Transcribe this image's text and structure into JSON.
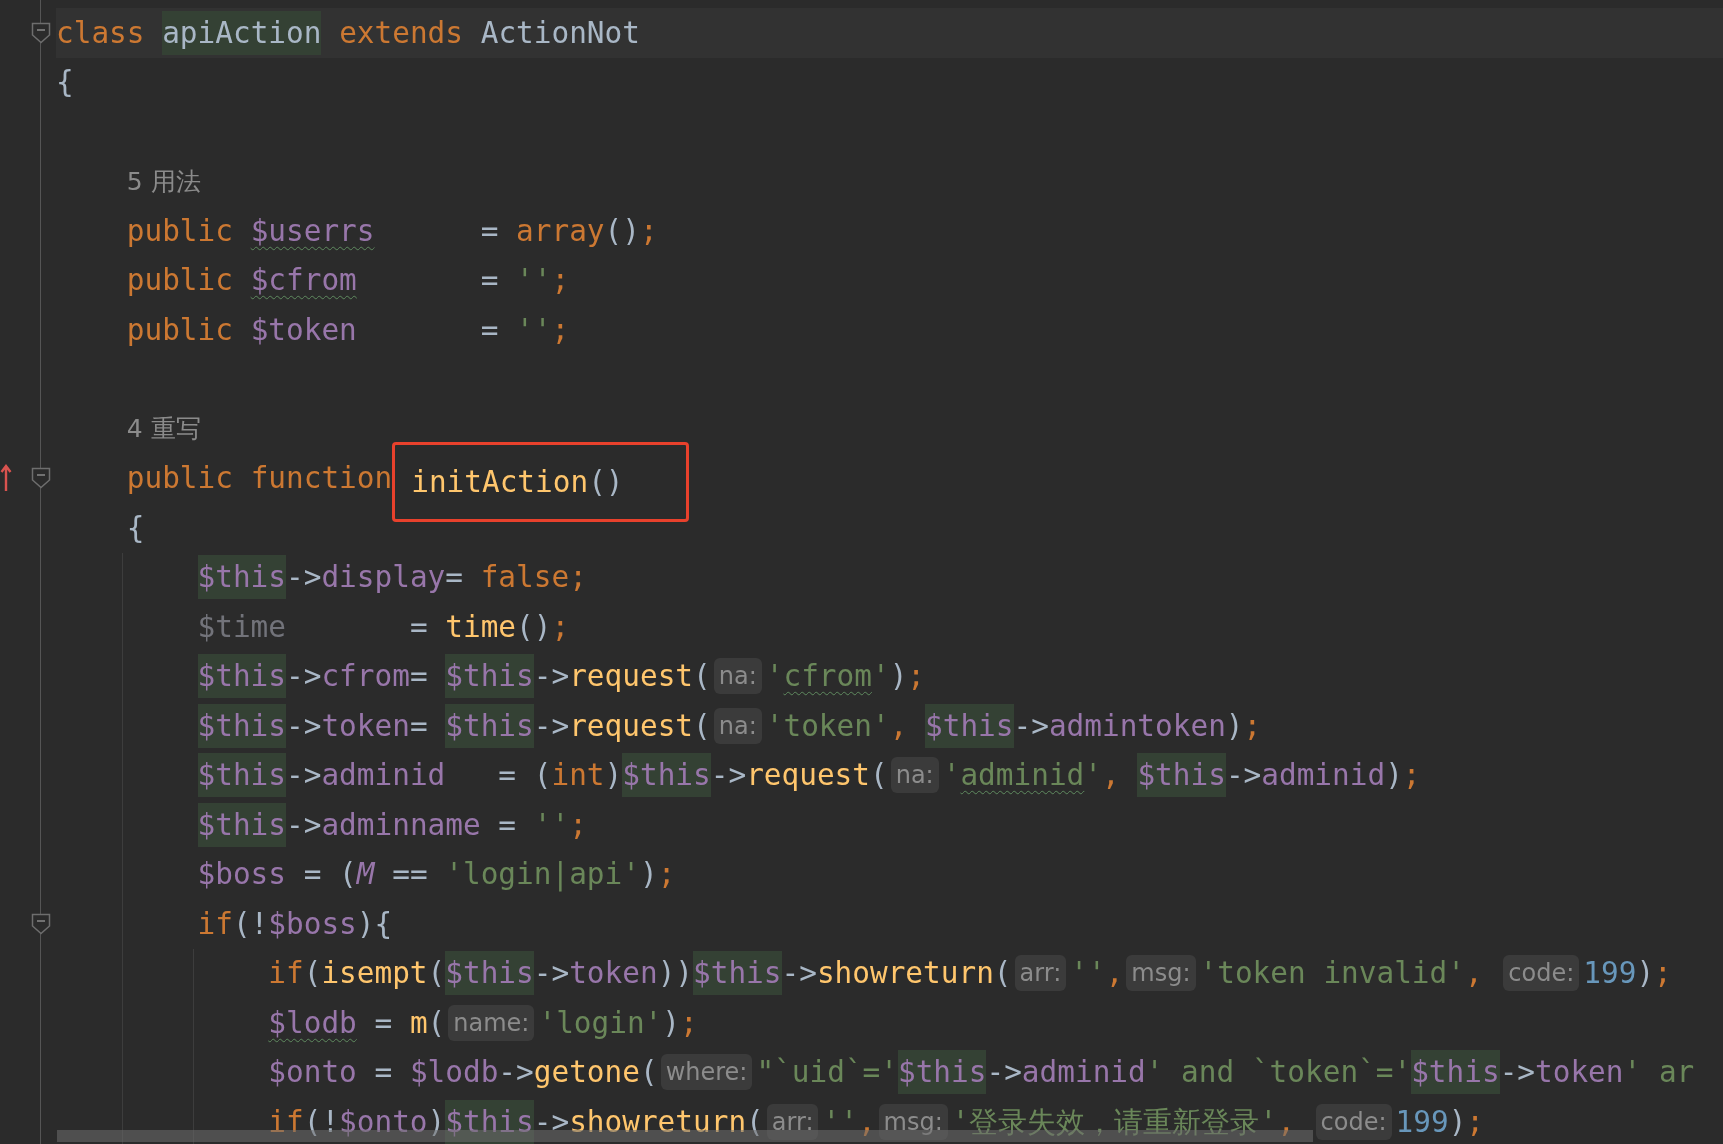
{
  "lines": [
    {
      "fold": true,
      "current": true,
      "tokens": [
        {
          "kind": "kw",
          "text": "class "
        },
        {
          "kind": "clshl",
          "text": "apiAction"
        },
        {
          "kind": "kw",
          "text": " extends "
        },
        {
          "kind": "cls",
          "text": "ActionNot"
        }
      ]
    },
    {
      "tokens": [
        {
          "kind": "plain",
          "text": "{"
        }
      ],
      "children": [
        {
          "kind": "blank"
        },
        {
          "kind": "usage",
          "text": "5 用法"
        },
        {
          "tokens": [
            {
              "kind": "kw",
              "text": "public "
            },
            {
              "kind": "var",
              "text": "$userrs",
              "typo": true
            },
            {
              "kind": "plain",
              "text": "      = "
            },
            {
              "kind": "kw",
              "text": "array"
            },
            {
              "kind": "plain",
              "text": "()"
            },
            {
              "kind": "punct",
              "text": ";"
            }
          ]
        },
        {
          "tokens": [
            {
              "kind": "kw",
              "text": "public "
            },
            {
              "kind": "var",
              "text": "$cfrom",
              "typo": true
            },
            {
              "kind": "plain",
              "text": "       = "
            },
            {
              "kind": "str",
              "text": "''"
            },
            {
              "kind": "punct",
              "text": ";"
            }
          ]
        },
        {
          "tokens": [
            {
              "kind": "kw",
              "text": "public "
            },
            {
              "kind": "var",
              "text": "$token"
            },
            {
              "kind": "plain",
              "text": "       = "
            },
            {
              "kind": "str",
              "text": "''"
            },
            {
              "kind": "punct",
              "text": ";"
            }
          ]
        },
        {
          "kind": "blank"
        },
        {
          "kind": "usage",
          "text": "4 重写"
        },
        {
          "fold": true,
          "override": true,
          "tokens": [
            {
              "kind": "kw",
              "text": "public function"
            },
            {
              "kind": "fn",
              "text": "initAction",
              "boxed": true
            },
            {
              "kind": "plain",
              "text": "()",
              "boxed": true
            }
          ]
        },
        {
          "tokens": [
            {
              "kind": "plain",
              "text": "{"
            }
          ],
          "children": [
            {
              "tokens": [
                {
                  "kind": "this",
                  "text": "$this"
                },
                {
                  "kind": "plain",
                  "text": "->"
                },
                {
                  "kind": "var",
                  "text": "display"
                },
                {
                  "kind": "plain",
                  "text": "= "
                },
                {
                  "kind": "kw",
                  "text": "false"
                },
                {
                  "kind": "punct",
                  "text": ";"
                }
              ]
            },
            {
              "tokens": [
                {
                  "kind": "unused",
                  "text": "$time"
                },
                {
                  "kind": "plain",
                  "text": "       = "
                },
                {
                  "kind": "fn",
                  "text": "time"
                },
                {
                  "kind": "plain",
                  "text": "()"
                },
                {
                  "kind": "punct",
                  "text": ";"
                }
              ]
            },
            {
              "tokens": [
                {
                  "kind": "this",
                  "text": "$this"
                },
                {
                  "kind": "plain",
                  "text": "->"
                },
                {
                  "kind": "var",
                  "text": "cfrom"
                },
                {
                  "kind": "plain",
                  "text": "= "
                },
                {
                  "kind": "this",
                  "text": "$this"
                },
                {
                  "kind": "plain",
                  "text": "->"
                },
                {
                  "kind": "fn",
                  "text": "request"
                },
                {
                  "kind": "plain",
                  "text": "("
                },
                {
                  "kind": "hint",
                  "text": "na:"
                },
                {
                  "kind": "str",
                  "text": "'"
                },
                {
                  "kind": "str",
                  "text": "cfrom",
                  "typo": true
                },
                {
                  "kind": "str",
                  "text": "'"
                },
                {
                  "kind": "plain",
                  "text": ")"
                },
                {
                  "kind": "punct",
                  "text": ";"
                }
              ]
            },
            {
              "tokens": [
                {
                  "kind": "this",
                  "text": "$this"
                },
                {
                  "kind": "plain",
                  "text": "->"
                },
                {
                  "kind": "var",
                  "text": "token"
                },
                {
                  "kind": "plain",
                  "text": "= "
                },
                {
                  "kind": "this",
                  "text": "$this"
                },
                {
                  "kind": "plain",
                  "text": "->"
                },
                {
                  "kind": "fn",
                  "text": "request"
                },
                {
                  "kind": "plain",
                  "text": "("
                },
                {
                  "kind": "hint",
                  "text": "na:"
                },
                {
                  "kind": "str",
                  "text": "'token'"
                },
                {
                  "kind": "punct",
                  "text": ", "
                },
                {
                  "kind": "this",
                  "text": "$this"
                },
                {
                  "kind": "plain",
                  "text": "->"
                },
                {
                  "kind": "var",
                  "text": "admintoken"
                },
                {
                  "kind": "plain",
                  "text": ")"
                },
                {
                  "kind": "punct",
                  "text": ";"
                }
              ]
            },
            {
              "tokens": [
                {
                  "kind": "this",
                  "text": "$this"
                },
                {
                  "kind": "plain",
                  "text": "->"
                },
                {
                  "kind": "var",
                  "text": "adminid"
                },
                {
                  "kind": "plain",
                  "text": "   = ("
                },
                {
                  "kind": "kw",
                  "text": "int"
                },
                {
                  "kind": "plain",
                  "text": ")"
                },
                {
                  "kind": "this",
                  "text": "$this"
                },
                {
                  "kind": "plain",
                  "text": "->"
                },
                {
                  "kind": "fn",
                  "text": "request"
                },
                {
                  "kind": "plain",
                  "text": "("
                },
                {
                  "kind": "hint",
                  "text": "na:"
                },
                {
                  "kind": "str",
                  "text": "'"
                },
                {
                  "kind": "str",
                  "text": "adminid",
                  "typo": true
                },
                {
                  "kind": "str",
                  "text": "'"
                },
                {
                  "kind": "punct",
                  "text": ", "
                },
                {
                  "kind": "this",
                  "text": "$this"
                },
                {
                  "kind": "plain",
                  "text": "->"
                },
                {
                  "kind": "var",
                  "text": "adminid"
                },
                {
                  "kind": "plain",
                  "text": ")"
                },
                {
                  "kind": "punct",
                  "text": ";"
                }
              ]
            },
            {
              "tokens": [
                {
                  "kind": "this",
                  "text": "$this"
                },
                {
                  "kind": "plain",
                  "text": "->"
                },
                {
                  "kind": "var",
                  "text": "adminname"
                },
                {
                  "kind": "plain",
                  "text": " = "
                },
                {
                  "kind": "str",
                  "text": "''"
                },
                {
                  "kind": "punct",
                  "text": ";"
                }
              ]
            },
            {
              "tokens": [
                {
                  "kind": "var",
                  "text": "$boss"
                },
                {
                  "kind": "plain",
                  "text": " = ("
                },
                {
                  "kind": "const",
                  "text": "M"
                },
                {
                  "kind": "plain",
                  "text": " == "
                },
                {
                  "kind": "str",
                  "text": "'login|api'"
                },
                {
                  "kind": "plain",
                  "text": ")"
                },
                {
                  "kind": "punct",
                  "text": ";"
                }
              ]
            },
            {
              "fold": true,
              "tokens": [
                {
                  "kind": "kw",
                  "text": "if"
                },
                {
                  "kind": "plain",
                  "text": "(!"
                },
                {
                  "kind": "var",
                  "text": "$boss"
                },
                {
                  "kind": "plain",
                  "text": "){"
                }
              ],
              "children": [
                {
                  "tokens": [
                    {
                      "kind": "kw",
                      "text": "if"
                    },
                    {
                      "kind": "plain",
                      "text": "("
                    },
                    {
                      "kind": "fn",
                      "text": "isempt"
                    },
                    {
                      "kind": "plain",
                      "text": "("
                    },
                    {
                      "kind": "this",
                      "text": "$this"
                    },
                    {
                      "kind": "plain",
                      "text": "->"
                    },
                    {
                      "kind": "var",
                      "text": "token"
                    },
                    {
                      "kind": "plain",
                      "text": "))"
                    },
                    {
                      "kind": "this",
                      "text": "$this"
                    },
                    {
                      "kind": "plain",
                      "text": "->"
                    },
                    {
                      "kind": "fn",
                      "text": "showreturn"
                    },
                    {
                      "kind": "plain",
                      "text": "("
                    },
                    {
                      "kind": "hint",
                      "text": "arr:"
                    },
                    {
                      "kind": "str",
                      "text": "''"
                    },
                    {
                      "kind": "punct",
                      "text": ","
                    },
                    {
                      "kind": "hint",
                      "text": "msg:"
                    },
                    {
                      "kind": "str",
                      "text": "'token invalid'"
                    },
                    {
                      "kind": "punct",
                      "text": ", "
                    },
                    {
                      "kind": "hint",
                      "text": "code:"
                    },
                    {
                      "kind": "num",
                      "text": "199"
                    },
                    {
                      "kind": "plain",
                      "text": ")"
                    },
                    {
                      "kind": "punct",
                      "text": ";"
                    }
                  ]
                },
                {
                  "tokens": [
                    {
                      "kind": "var",
                      "text": "$lodb",
                      "typo": true
                    },
                    {
                      "kind": "plain",
                      "text": " = "
                    },
                    {
                      "kind": "fn",
                      "text": "m"
                    },
                    {
                      "kind": "plain",
                      "text": "("
                    },
                    {
                      "kind": "hint",
                      "text": "name:"
                    },
                    {
                      "kind": "str",
                      "text": "'login'"
                    },
                    {
                      "kind": "plain",
                      "text": ")"
                    },
                    {
                      "kind": "punct",
                      "text": ";"
                    }
                  ]
                },
                {
                  "tokens": [
                    {
                      "kind": "var",
                      "text": "$onto"
                    },
                    {
                      "kind": "plain",
                      "text": " = "
                    },
                    {
                      "kind": "var",
                      "text": "$lodb"
                    },
                    {
                      "kind": "plain",
                      "text": "->"
                    },
                    {
                      "kind": "fn",
                      "text": "getone"
                    },
                    {
                      "kind": "plain",
                      "text": "("
                    },
                    {
                      "kind": "hint",
                      "text": "where:"
                    },
                    {
                      "kind": "str",
                      "text": "\"`uid`='"
                    },
                    {
                      "kind": "this",
                      "text": "$this"
                    },
                    {
                      "kind": "plain",
                      "text": "->"
                    },
                    {
                      "kind": "var",
                      "text": "adminid"
                    },
                    {
                      "kind": "str",
                      "text": "' and `token`='"
                    },
                    {
                      "kind": "this",
                      "text": "$this"
                    },
                    {
                      "kind": "plain",
                      "text": "->"
                    },
                    {
                      "kind": "var",
                      "text": "token"
                    },
                    {
                      "kind": "str",
                      "text": "' ar"
                    }
                  ]
                },
                {
                  "tokens": [
                    {
                      "kind": "kw",
                      "text": "if"
                    },
                    {
                      "kind": "plain",
                      "text": "(!"
                    },
                    {
                      "kind": "var",
                      "text": "$onto"
                    },
                    {
                      "kind": "plain",
                      "text": ")"
                    },
                    {
                      "kind": "this",
                      "text": "$this"
                    },
                    {
                      "kind": "plain",
                      "text": "->"
                    },
                    {
                      "kind": "fn",
                      "text": "showreturn"
                    },
                    {
                      "kind": "plain",
                      "text": "("
                    },
                    {
                      "kind": "hint",
                      "text": "arr:"
                    },
                    {
                      "kind": "str",
                      "text": "''"
                    },
                    {
                      "kind": "punct",
                      "text": ","
                    },
                    {
                      "kind": "hint",
                      "text": "msg:"
                    },
                    {
                      "kind": "str",
                      "text": "'登录失效，请重新登录'"
                    },
                    {
                      "kind": "punct",
                      "text": ", "
                    },
                    {
                      "kind": "hint",
                      "text": "code:"
                    },
                    {
                      "kind": "num",
                      "text": "199"
                    },
                    {
                      "kind": "plain",
                      "text": ")"
                    },
                    {
                      "kind": "punct",
                      "text": ";"
                    }
                  ]
                }
              ]
            }
          ]
        }
      ]
    }
  ]
}
